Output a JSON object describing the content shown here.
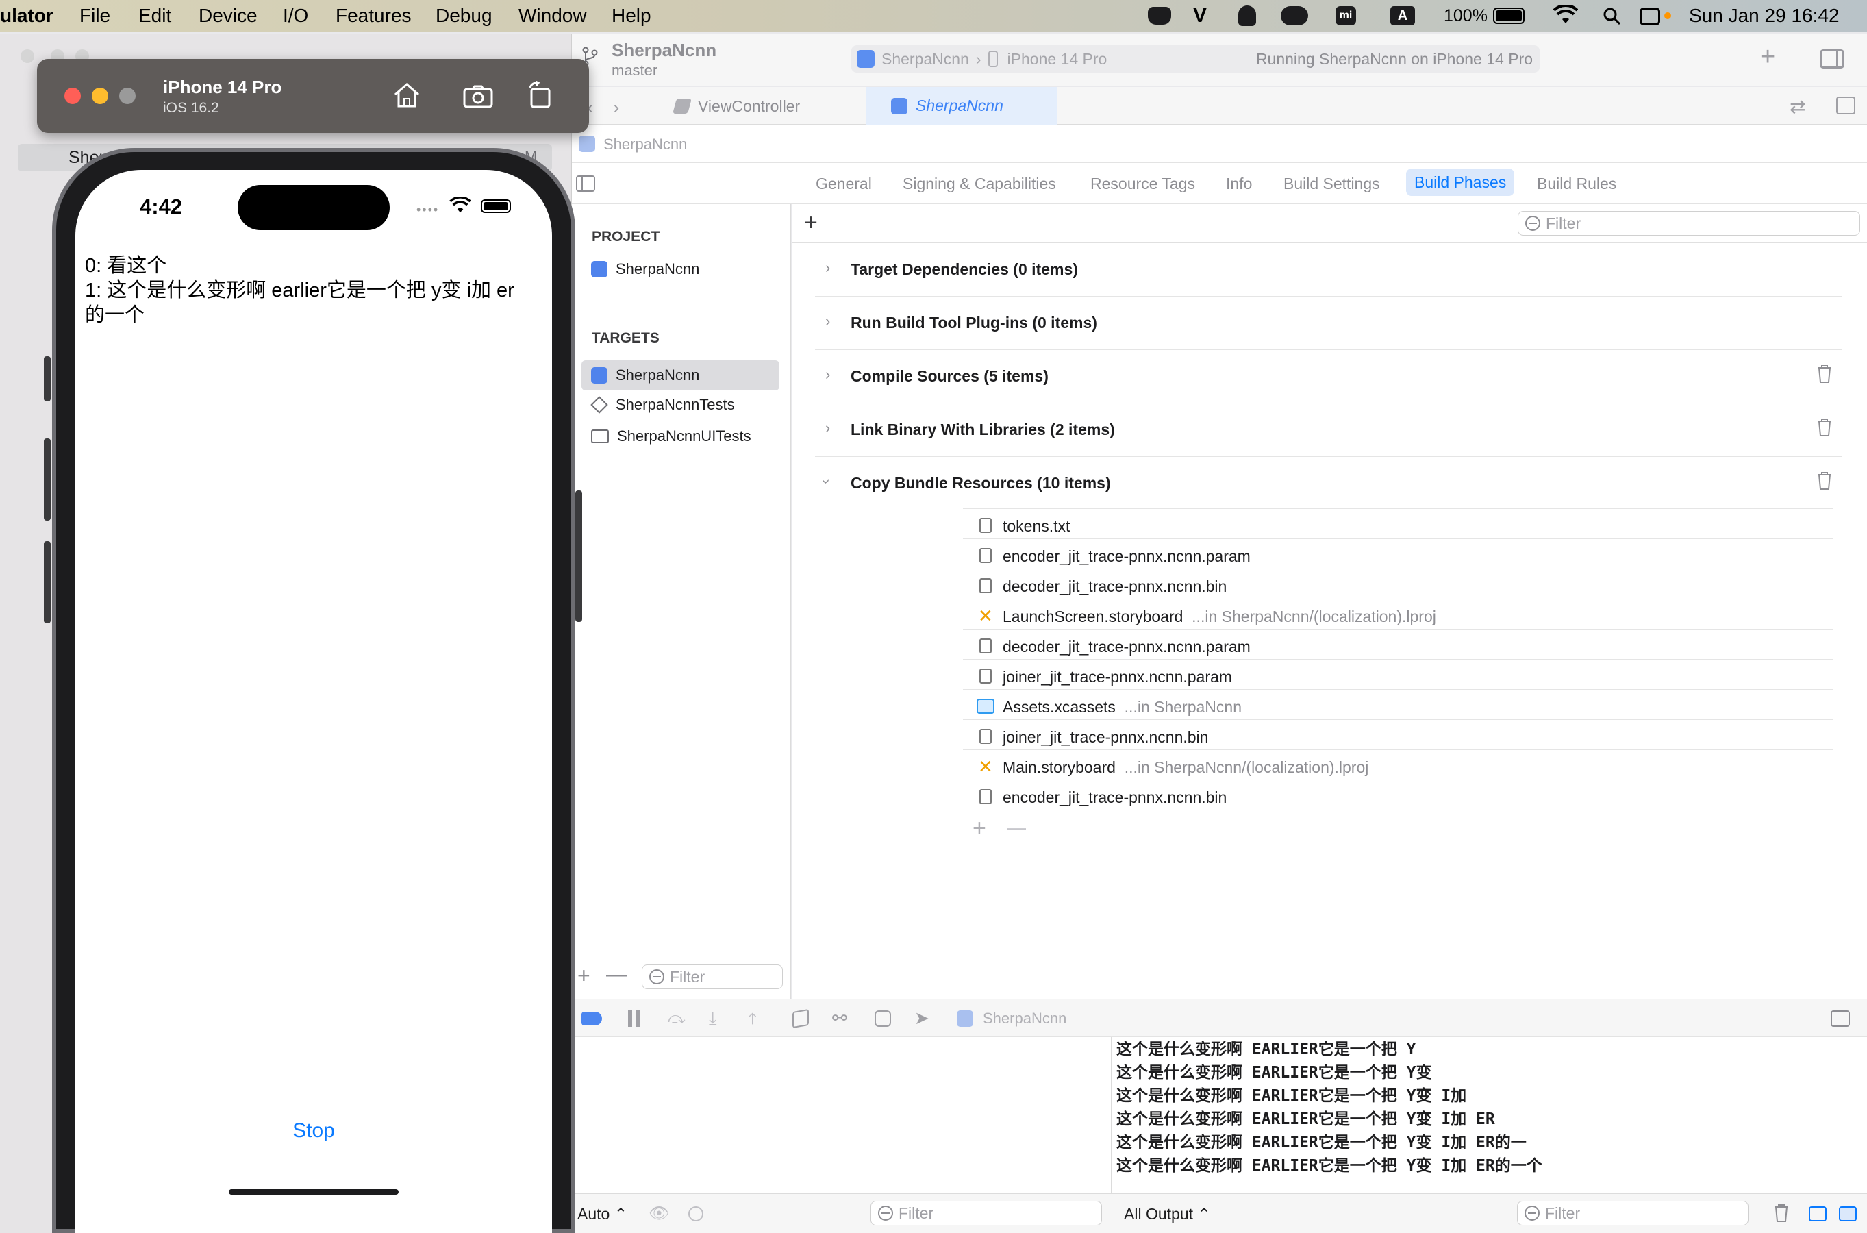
{
  "menubar": {
    "app": "ulator",
    "items": [
      "File",
      "Edit",
      "Device",
      "I/O",
      "Features",
      "Debug",
      "Window",
      "Help"
    ],
    "battery": "100%",
    "datetime": "Sun Jan 29  16:42",
    "input_source": "A"
  },
  "simulator": {
    "device_name": "iPhone 14 Pro",
    "os_version": "iOS 16.2",
    "status_time": "4:42",
    "transcript_line0": "0: 看这个",
    "transcript_line1": "1: 这个是什么变形啊 earlier它是一个把 y变 i加 er",
    "transcript_line1b": "的一个",
    "stop_label": "Stop"
  },
  "xcode": {
    "project_name": "SherpaNcnn",
    "branch": "master",
    "scheme": "SherpaNcnn",
    "destination": "iPhone 14 Pro",
    "status": "Running SherpaNcnn on iPhone 14 Pro",
    "behind_sidebar_item": "Sherp",
    "tabs": [
      "ViewController",
      "SherpaNcnn"
    ],
    "jump_item": "SherpaNcnn",
    "editor_tabs": [
      "General",
      "Signing & Capabilities",
      "Resource Tags",
      "Info",
      "Build Settings",
      "Build Phases",
      "Build Rules"
    ],
    "project_header": "PROJECT",
    "project_item": "SherpaNcnn",
    "targets_header": "TARGETS",
    "targets": [
      "SherpaNcnn",
      "SherpaNcnnTests",
      "SherpaNcnnUITests"
    ],
    "filter_placeholder": "Filter",
    "phases": [
      "Target Dependencies (0 items)",
      "Run Build Tool Plug-ins (0 items)",
      "Compile Sources (5 items)",
      "Link Binary With Libraries (2 items)",
      "Copy Bundle Resources (10 items)"
    ],
    "resources": [
      {
        "name": "tokens.txt",
        "loc": ""
      },
      {
        "name": "encoder_jit_trace-pnnx.ncnn.param",
        "loc": ""
      },
      {
        "name": "decoder_jit_trace-pnnx.ncnn.bin",
        "loc": ""
      },
      {
        "name": "LaunchScreen.storyboard",
        "loc": "...in SherpaNcnn/(localization).lproj"
      },
      {
        "name": "decoder_jit_trace-pnnx.ncnn.param",
        "loc": ""
      },
      {
        "name": "joiner_jit_trace-pnnx.ncnn.param",
        "loc": ""
      },
      {
        "name": "Assets.xcassets",
        "loc": "...in SherpaNcnn"
      },
      {
        "name": "joiner_jit_trace-pnnx.ncnn.bin",
        "loc": ""
      },
      {
        "name": "Main.storyboard",
        "loc": "...in SherpaNcnn/(localization).lproj"
      },
      {
        "name": "encoder_jit_trace-pnnx.ncnn.bin",
        "loc": ""
      }
    ],
    "debug_target": "SherpaNcnn",
    "console_lines": [
      "这个是什么变形啊 EARLIER它是一个把 Y",
      "这个是什么变形啊 EARLIER它是一个把 Y变",
      "这个是什么变形啊 EARLIER它是一个把 Y变 I加",
      "这个是什么变形啊 EARLIER它是一个把 Y变 I加 ER",
      "这个是什么变形啊 EARLIER它是一个把 Y变 I加 ER的一",
      "这个是什么变形啊 EARLIER它是一个把 Y变 I加 ER的一个"
    ],
    "vars_mode": "Auto",
    "output_mode": "All Output"
  },
  "colors": {
    "accent": "#0a7aff",
    "selected_tab_bg": "#dbe8fb",
    "close": "#ff5f57",
    "minimize": "#febc2e",
    "zoom": "#9a9a9a"
  }
}
